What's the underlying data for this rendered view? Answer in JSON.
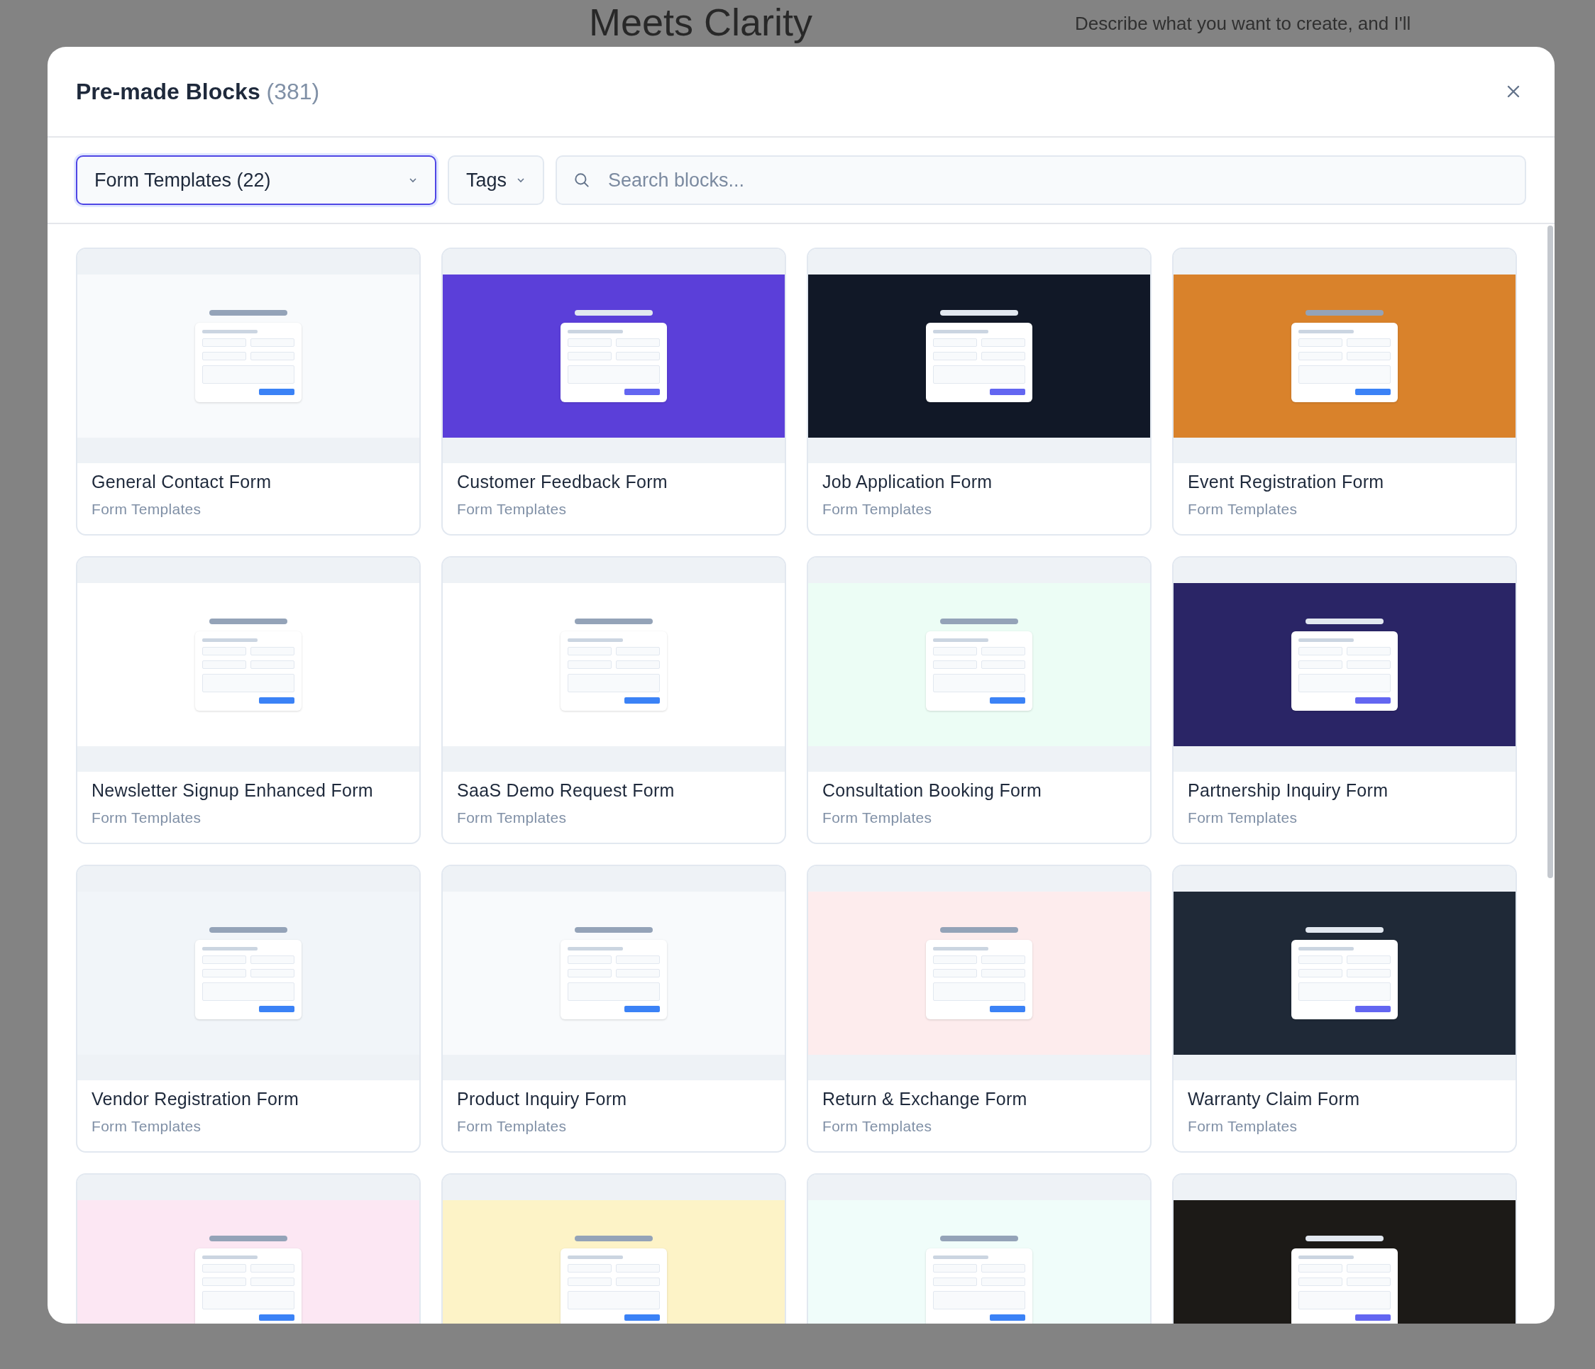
{
  "backdrop": {
    "heading": "Meets Clarity",
    "text": "Describe what you want to create, and I'll"
  },
  "dialog": {
    "title": "Pre-made Blocks",
    "count": "(381)"
  },
  "filters": {
    "category": "Form Templates (22)",
    "tags": "Tags",
    "search": {
      "placeholder": "Search blocks..."
    }
  },
  "blocks": [
    {
      "title": "General Contact Form",
      "category": "Form Templates",
      "color": "#f8fafc"
    },
    {
      "title": "Customer Feedback Form",
      "category": "Form Templates",
      "color": "#5b3fd9"
    },
    {
      "title": "Job Application Form",
      "category": "Form Templates",
      "color": "#111827"
    },
    {
      "title": "Event Registration Form",
      "category": "Form Templates",
      "color": "#d9822b"
    },
    {
      "title": "Newsletter Signup Enhanced Form",
      "category": "Form Templates",
      "color": "#ffffff"
    },
    {
      "title": "SaaS Demo Request Form",
      "category": "Form Templates",
      "color": "#ffffff"
    },
    {
      "title": "Consultation Booking Form",
      "category": "Form Templates",
      "color": "#ecfdf5"
    },
    {
      "title": "Partnership Inquiry Form",
      "category": "Form Templates",
      "color": "#2a2566"
    },
    {
      "title": "Vendor Registration Form",
      "category": "Form Templates",
      "color": "#f1f5f9"
    },
    {
      "title": "Product Inquiry Form",
      "category": "Form Templates",
      "color": "#f8fafc"
    },
    {
      "title": "Return & Exchange Form",
      "category": "Form Templates",
      "color": "#fdeced"
    },
    {
      "title": "Warranty Claim Form",
      "category": "Form Templates",
      "color": "#1f2937"
    },
    {
      "color": "#fce7f3"
    },
    {
      "color": "#fdf3c7"
    },
    {
      "color": "#f0fdfa"
    },
    {
      "color": "#1c1a17"
    }
  ]
}
